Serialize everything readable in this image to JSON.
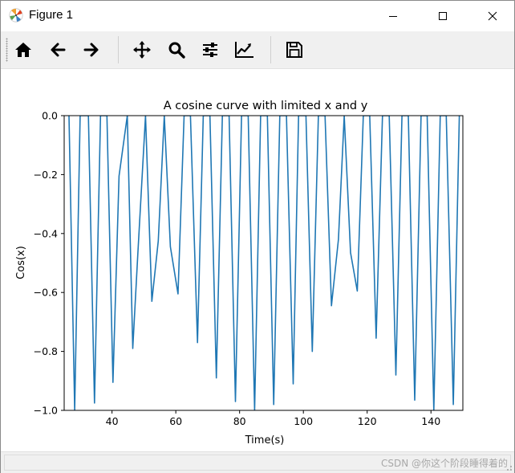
{
  "window": {
    "title": "Figure 1",
    "icon": "matplotlib-logo-icon",
    "controls": [
      "minimize-icon",
      "maximize-icon",
      "close-icon"
    ]
  },
  "toolbar": {
    "buttons": [
      {
        "id": "home",
        "icon": "home-icon"
      },
      {
        "id": "back",
        "icon": "arrow-left-icon"
      },
      {
        "id": "forward",
        "icon": "arrow-right-icon"
      },
      {
        "id": "pan",
        "icon": "move-icon"
      },
      {
        "id": "zoom",
        "icon": "magnifier-icon"
      },
      {
        "id": "subplots",
        "icon": "sliders-icon"
      },
      {
        "id": "edit-axes",
        "icon": "line-chart-icon"
      },
      {
        "id": "save",
        "icon": "floppy-disk-icon"
      }
    ]
  },
  "statusbar": {
    "watermark": "CSDN @你这个阶段睡得着的"
  },
  "chart_data": {
    "type": "line",
    "title": "A cosine curve with limited x and y",
    "xlabel": "Time(s)",
    "ylabel": "Cos(x)",
    "xlim": [
      25,
      150
    ],
    "ylim": [
      -1.0,
      0.0
    ],
    "xticks": [
      40,
      60,
      80,
      100,
      120,
      140
    ],
    "yticks": [
      0.0,
      -0.2,
      -0.4,
      -0.6,
      -0.8,
      -1.0
    ],
    "ytick_labels": [
      "0.0",
      "−0.2",
      "−0.4",
      "−0.6",
      "−0.8",
      "−1.0"
    ],
    "grid": false,
    "legend": "none",
    "line_color": "#1f77b4",
    "series": [
      {
        "x": [
          26.5,
          28.3,
          30.0,
          32.6,
          34.5,
          36.4,
          38.4,
          40.3,
          42.2,
          44.8,
          46.5,
          48.1,
          50.5,
          52.5,
          54.5,
          56.4,
          58.3,
          60.7,
          62.6,
          64.6,
          66.8,
          68.6,
          70.7,
          72.7,
          74.6,
          76.7,
          78.7,
          80.6,
          82.7,
          84.7,
          86.6,
          88.7,
          90.7,
          92.6,
          94.7,
          96.8,
          98.5,
          100.8,
          102.8,
          104.7,
          106.8,
          108.8,
          111.0,
          112.8,
          114.8,
          116.9,
          118.8,
          120.8,
          122.8,
          124.8,
          126.9,
          129.0,
          130.9,
          132.9,
          134.9,
          136.9,
          138.8,
          140.9,
          142.9,
          144.8,
          147.0,
          148.9
        ],
        "y": [
          0.0,
          -1.0,
          0.0,
          0.0,
          -0.975,
          0.0,
          0.0,
          -0.905,
          -0.205,
          0.0,
          -0.79,
          -0.47,
          0.0,
          -0.63,
          -0.425,
          0.0,
          -0.445,
          -0.605,
          0.0,
          0.0,
          -0.77,
          0.0,
          0.0,
          -0.89,
          0.0,
          0.0,
          -0.97,
          0.0,
          0.0,
          -1.0,
          0.0,
          0.0,
          -0.98,
          0.0,
          0.0,
          -0.91,
          0.0,
          0.0,
          -0.8,
          0.0,
          0.0,
          -0.645,
          -0.42,
          0.0,
          -0.465,
          -0.595,
          0.0,
          0.0,
          -0.755,
          0.0,
          0.0,
          -0.88,
          0.0,
          0.0,
          -0.965,
          0.0,
          0.0,
          -1.0,
          0.0,
          0.0,
          -0.98,
          0.0
        ]
      }
    ]
  }
}
